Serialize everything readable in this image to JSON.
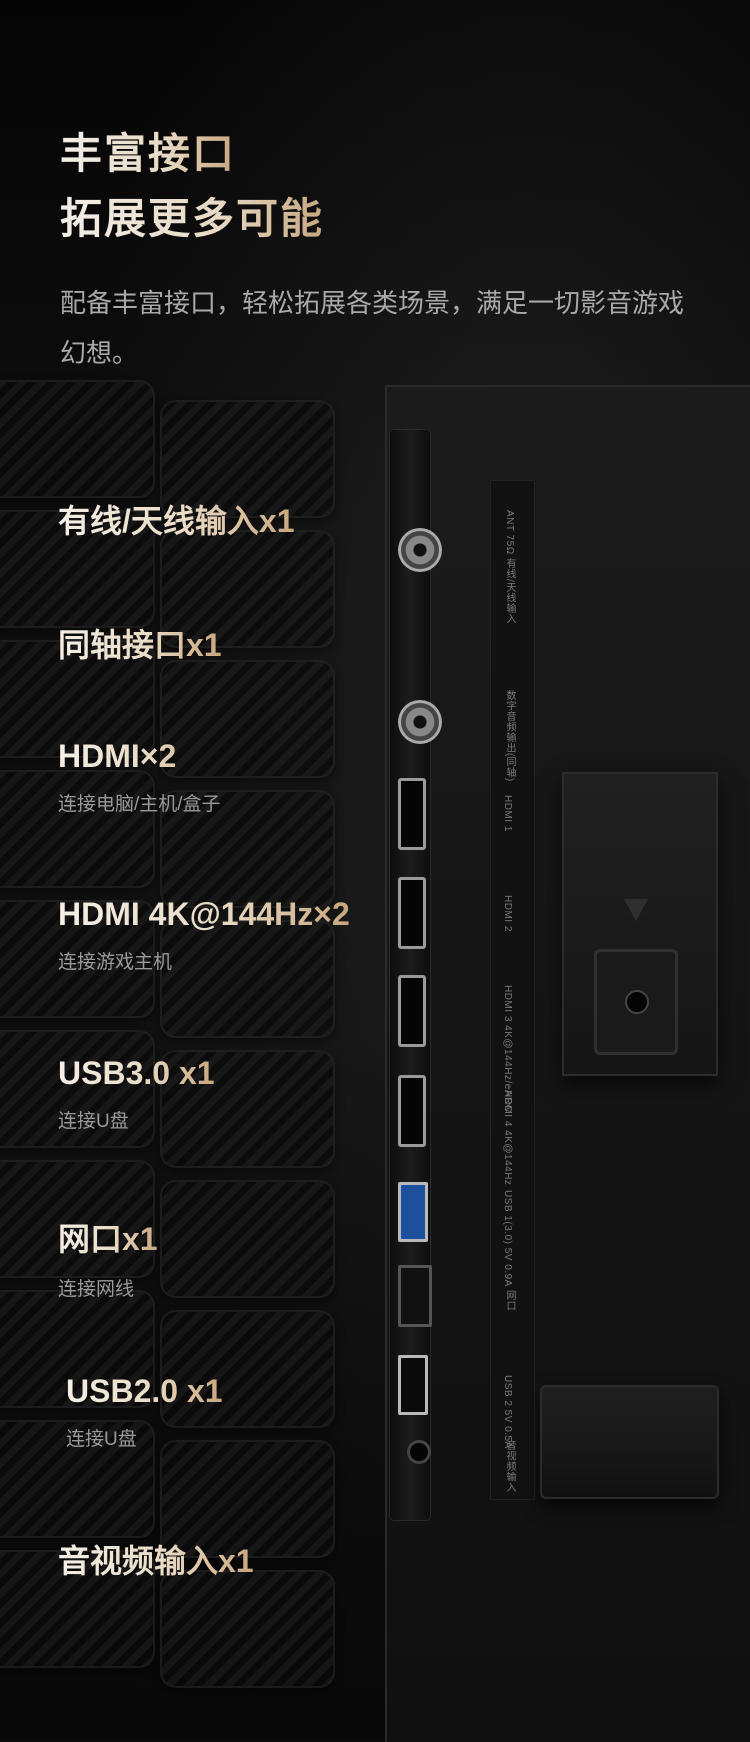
{
  "header": {
    "title_line1": "丰富接口",
    "title_line2": "拓展更多可能",
    "description": "配备丰富接口，轻松拓展各类场景，满足一切影音游戏幻想。"
  },
  "features": [
    {
      "name": "有线/天线输入x1",
      "sub": ""
    },
    {
      "name": "同轴接口x1",
      "sub": ""
    },
    {
      "name": "HDMI×2",
      "sub": "连接电脑/主机/盒子"
    },
    {
      "name": "HDMI 4K@144Hz×2",
      "sub": "连接游戏主机"
    },
    {
      "name": "USB3.0 x1",
      "sub": "连接U盘"
    },
    {
      "name": "网口x1",
      "sub": "连接网线"
    },
    {
      "name": "USB2.0 x1",
      "sub": "连接U盘"
    },
    {
      "name": "音视频输入x1",
      "sub": ""
    }
  ],
  "panel_labels": {
    "ant": "ANT 75Ω 有线/天线输入",
    "coax": "数字音频输出(同轴)",
    "hdmi1": "HDMI 1",
    "hdmi2": "HDMI 2",
    "hdmi3": "HDMI 3 4K@144Hz/eARC",
    "hdmi4": "HDMI 4 4K@144Hz",
    "usb1": "USB 1(3.0) 5V 0.9A",
    "lan": "网口",
    "usb2": "USB 2 5V 0.5A",
    "av": "音视频输入"
  }
}
